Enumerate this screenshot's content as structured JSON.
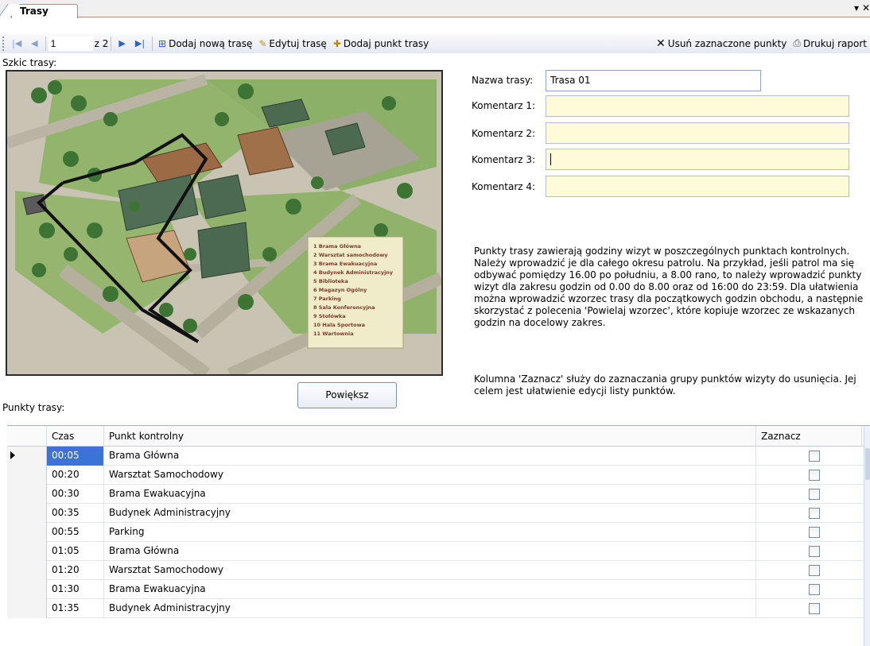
{
  "tab": {
    "title": "Trasy"
  },
  "toolbar": {
    "position": "1",
    "of_label": "z 2",
    "add_route": "Dodaj nową trasę",
    "edit_route": "Edytuj trasę",
    "add_point": "Dodaj punkt trasy",
    "delete_selected": "Usuń zaznaczone punkty",
    "print_report": "Drukuj raport"
  },
  "sketch_label": "Szkic trasy:",
  "map": {
    "legend": [
      "1  Brama Główna",
      "2  Warsztat samochodowy",
      "3  Brama Ewakuacyjna",
      "4  Budynek Administracyjny",
      "5  Biblioteka",
      "6  Magazyn Ogólny",
      "7  Parking",
      "8  Sala Konferencyjna",
      "9  Stołówka",
      "10  Hala Sportowa",
      "11  Wartownia"
    ],
    "colors": {
      "ground": "#c9c5b6",
      "grass": "#8fb26a",
      "trees": "#3f7a34",
      "route": "#111111"
    }
  },
  "zoom_button": "Powiększ",
  "points_label": "Punkty trasy:",
  "form": {
    "name_label": "Nazwa trasy:",
    "name_value": "Trasa 01",
    "comment1_label": "Komentarz 1:",
    "comment2_label": "Komentarz 2:",
    "comment3_label": "Komentarz 3:",
    "comment4_label": "Komentarz 4:",
    "comment1_value": "",
    "comment2_value": "",
    "comment3_value": "",
    "comment4_value": ""
  },
  "info": {
    "paragraph1": "Punkty trasy zawierają godziny wizyt w poszczególnych punktach kontrolnych. Należy wprowadzić je dla całego okresu patrolu.  Na przykład, jeśli patrol ma się odbywać pomiędzy 16.00 po południu, a 8.00 rano, to należy wprowadzić punkty wizyt dla zakresu godzin od 0.00 do 8.00 oraz od 16:00 do 23:59. Dla ułatwienia można wprowadzić wzorzec trasy dla początkowych godzin obchodu, a następnie skorzystać z polecenia 'Powielaj wzorzec', które kopiuje wzorzec ze wskazanych godzin na docelowy zakres.",
    "paragraph2": "Kolumna 'Zaznacz' służy do zaznaczania grupy punktów wizyty do usunięcia. Jej celem jest ułatwienie edycji listy punktów."
  },
  "grid": {
    "headers": {
      "time": "Czas",
      "point": "Punkt kontrolny",
      "select": "Zaznacz"
    },
    "rows": [
      {
        "time": "00:05",
        "point": "Brama Główna"
      },
      {
        "time": "00:20",
        "point": "Warsztat Samochodowy"
      },
      {
        "time": "00:30",
        "point": "Brama Ewakuacyjna"
      },
      {
        "time": "00:35",
        "point": "Budynek Administracyjny"
      },
      {
        "time": "00:55",
        "point": "Parking"
      },
      {
        "time": "01:05",
        "point": "Brama Główna"
      },
      {
        "time": "01:20",
        "point": "Warsztat Samochodowy"
      },
      {
        "time": "01:30",
        "point": "Brama Ewakuacyjna"
      },
      {
        "time": "01:35",
        "point": "Budynek Administracyjny"
      }
    ]
  }
}
